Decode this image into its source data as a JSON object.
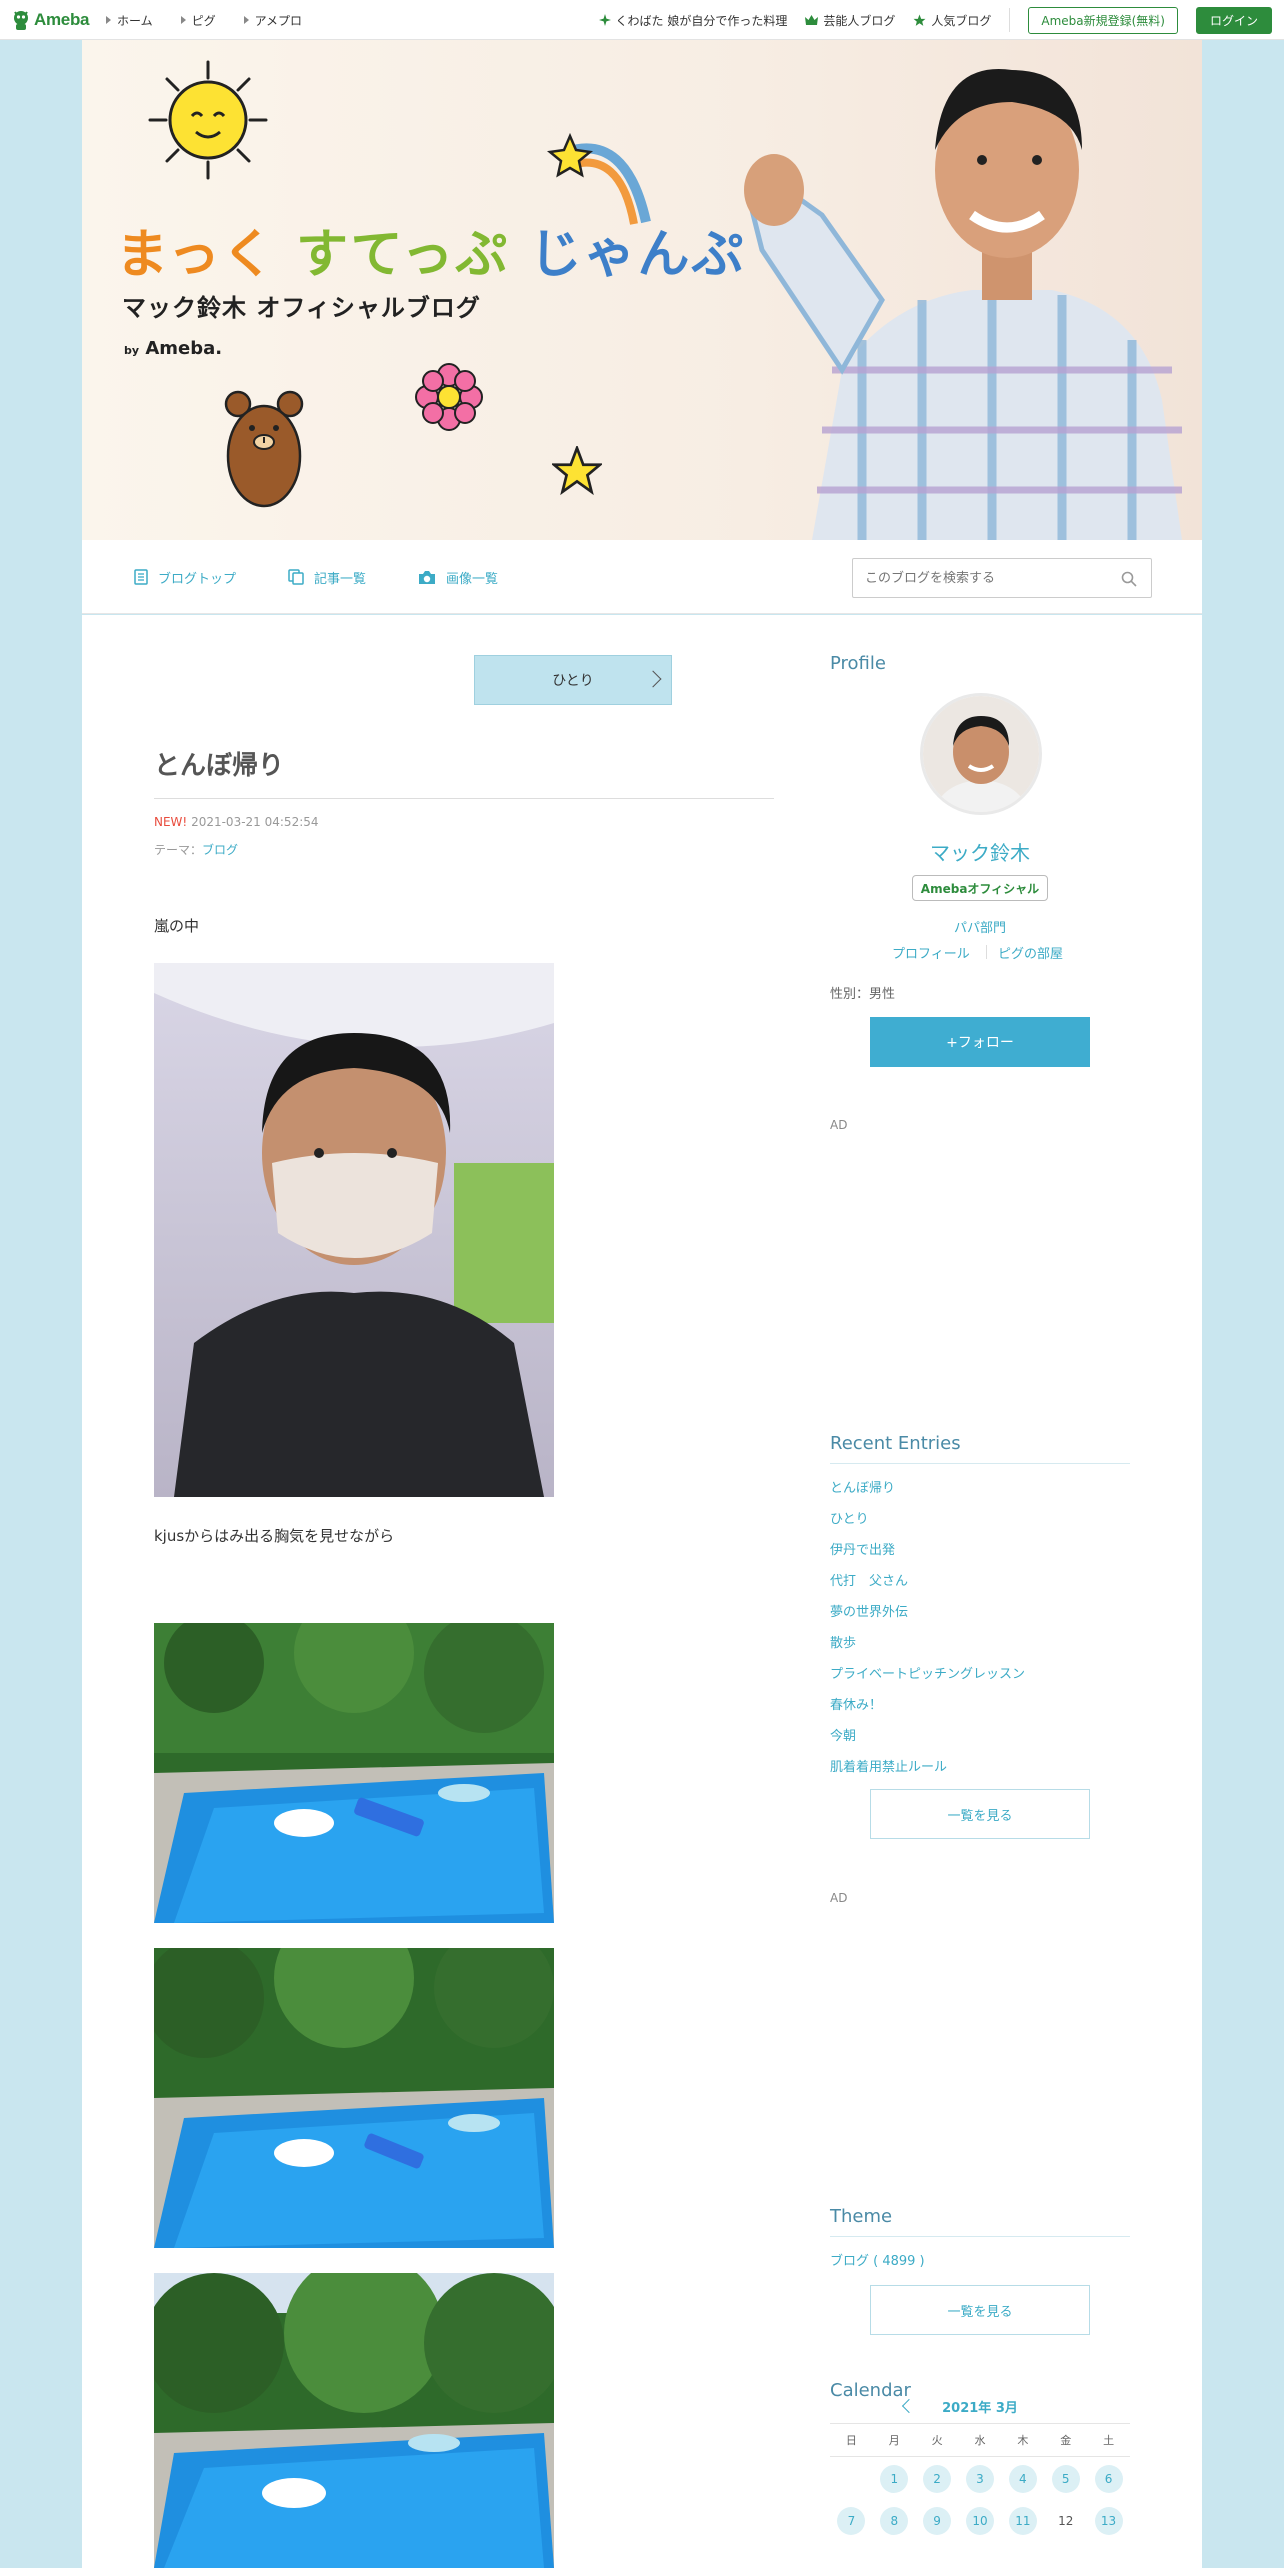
{
  "global": {
    "logo": "Ameba",
    "nav": [
      "ホーム",
      "ピグ",
      "アメプロ"
    ],
    "highlights": [
      "くわばた 娘が自分で作った料理",
      "芸能人ブログ",
      "人気ブログ"
    ],
    "register_label": "Ameba新規登録(無料)",
    "login_label": "ログイン"
  },
  "header": {
    "title_part1": "まっく",
    "title_part2": "すてっぷ",
    "title_part3": "じゃんぷ",
    "subtitle": "マック鈴木 オフィシャルブログ",
    "by_prefix": "by",
    "by_brand": "Ameba."
  },
  "blog_nav": {
    "links": [
      "ブログトップ",
      "記事一覧",
      "画像一覧"
    ],
    "search_placeholder": "このブログを検索する"
  },
  "entry": {
    "nav_label": "ひとり",
    "title": "とんぼ帰り",
    "new_label": "NEW!",
    "datetime": "2021-03-21 04:52:54",
    "theme_label": "テーマ：",
    "theme_value": "ブログ",
    "para1": "嵐の中",
    "para2": "kjusからはみ出る胸気を見せながら"
  },
  "sidebar": {
    "profile_heading": "Profile",
    "name": "マック鈴木",
    "badge": "Amebaオフィシャル",
    "genre": "パパ部門",
    "profile_link": "プロフィール",
    "pig_link": "ピグの部屋",
    "sex": "性別：男性",
    "follow_label": "+フォロー",
    "ad_label": "AD",
    "recent_heading": "Recent Entries",
    "recent_entries": [
      "とんぼ帰り",
      "ひとり",
      "伊丹で出発",
      "代打　父さん",
      "夢の世界外伝",
      "散歩",
      "プライベートピッチングレッスン",
      "春休み！",
      "今朝",
      "肌着着用禁止ルール"
    ],
    "more_label": "一覧を見る",
    "theme_heading": "Theme",
    "theme_item": "ブログ ( 4899 )",
    "calendar_heading": "Calendar",
    "calendar_month": "2021年 3月",
    "weekdays": [
      "日",
      "月",
      "火",
      "水",
      "木",
      "金",
      "土"
    ],
    "days_row1": [
      "",
      "1",
      "2",
      "3",
      "4",
      "5",
      "6"
    ],
    "days_row2": [
      "7",
      "8",
      "9",
      "10",
      "11",
      "12",
      "13"
    ]
  },
  "colors": {
    "brand_green": "#2d8c3c",
    "accent_blue": "#3cabc6",
    "page_bg": "#c9e6ef",
    "follow_bg": "#3fadd1"
  }
}
